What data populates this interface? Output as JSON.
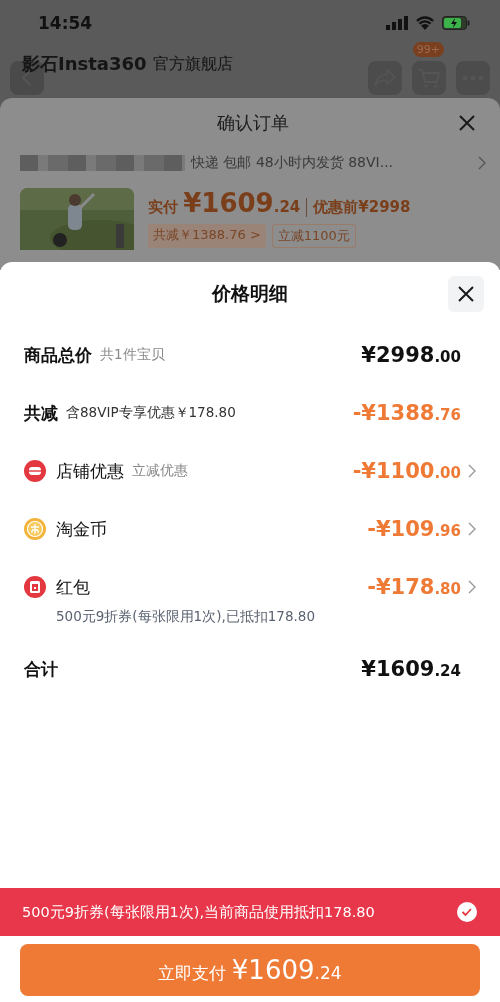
{
  "status_bar": {
    "time": "14:54"
  },
  "store_header": {
    "brand": "影石Insta360",
    "suffix": "官方旗舰店",
    "cart_badge": "99+"
  },
  "order_sheet": {
    "title": "确认订单",
    "shipping": "快递 包邮 48小时内发货  88VI...",
    "paid_label": "实付",
    "paid_main": "¥1609",
    "paid_cents": ".24",
    "original_label": "优惠前",
    "original_price": "¥2998",
    "tags": [
      {
        "label": "共减￥1388.76 >",
        "kind": "discount"
      },
      {
        "label": "立减1100元",
        "kind": "plain"
      }
    ]
  },
  "price_detail": {
    "title": "价格明细",
    "rows": [
      {
        "kind": "sum",
        "label": "商品总价",
        "note": "共1件宝贝",
        "main": "¥2998",
        "cents": ".00"
      },
      {
        "kind": "saving",
        "label": "共减",
        "note": "含88VIP专享优惠￥178.80",
        "main": "-¥1388",
        "cents": ".76"
      },
      {
        "kind": "shop",
        "label": "店铺优惠",
        "note": "立减优惠",
        "main": "-¥1100",
        "cents": ".00"
      },
      {
        "kind": "coin",
        "label": "淘金币",
        "main": "-¥109",
        "cents": ".96"
      },
      {
        "kind": "packet",
        "label": "红包",
        "main": "-¥178",
        "cents": ".80",
        "detail": "500元9折券(每张限用1次),已抵扣178.80"
      },
      {
        "kind": "sum",
        "label": "合计",
        "main": "¥1609",
        "cents": ".24"
      }
    ]
  },
  "coupon_banner": {
    "text": "500元9折券(每张限用1次),当前商品使用抵扣178.80",
    "checked": true
  },
  "pay_button": {
    "label": "立即支付",
    "main": "¥1609",
    "cents": ".24"
  }
}
